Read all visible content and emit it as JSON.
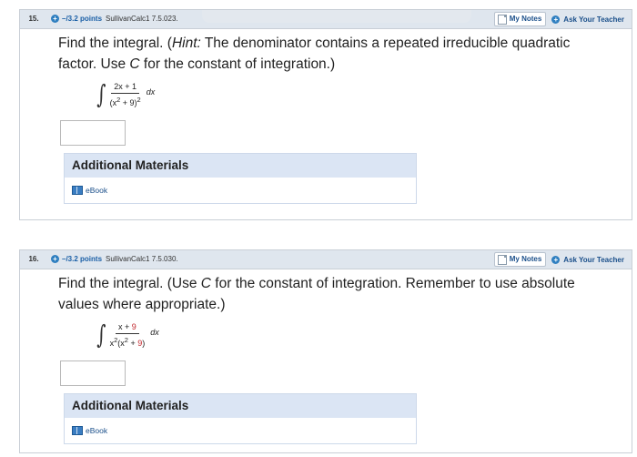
{
  "questions": [
    {
      "number": "15.",
      "points": "–/3.2 points",
      "source": "SullivanCalc1 7.5.023.",
      "my_notes": "My Notes",
      "ask_teacher": "Ask Your Teacher",
      "prompt_a": "Find the integral. (",
      "prompt_hint": "Hint:",
      "prompt_b": " The denominator contains a repeated irreducible quadratic factor. Use ",
      "prompt_c_var": "C",
      "prompt_c": " for the constant of integration.)",
      "integral": {
        "numerator": "2x + 1",
        "denominator_a": "(x",
        "denominator_b": "2",
        "denominator_c": " + 9)",
        "denominator_d": "2",
        "dx": "dx"
      },
      "materials_title": "Additional Materials",
      "ebook_label": "eBook"
    },
    {
      "number": "16.",
      "points": "–/3.2 points",
      "source": "SullivanCalc1 7.5.030.",
      "my_notes": "My Notes",
      "ask_teacher": "Ask Your Teacher",
      "prompt_a": "Find the integral. (Use ",
      "prompt_c_var": "C",
      "prompt_c": " for the constant of integration. Remember to use absolute values where appropriate.)",
      "integral": {
        "numerator_a": "x + ",
        "numerator_b": "9",
        "denominator_a": "x",
        "denominator_b": "2",
        "denominator_c": "(x",
        "denominator_d": "2",
        "denominator_e": " + ",
        "denominator_f": "9",
        "denominator_g": ")",
        "dx": "dx"
      },
      "materials_title": "Additional Materials",
      "ebook_label": "eBook"
    }
  ],
  "colors": {
    "header_bg": "#dfe6ee",
    "link_blue": "#1a4f8a",
    "accent_red": "#c0262c",
    "materials_bg": "#dbe5f4"
  }
}
